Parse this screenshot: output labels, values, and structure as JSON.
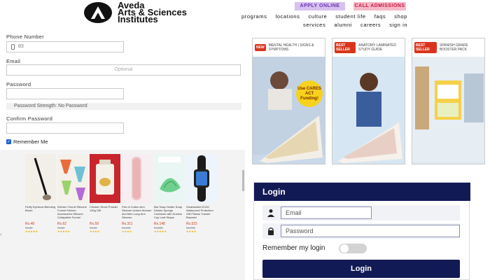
{
  "header": {
    "logo_text": "Aveda\nArts & Sciences\nInstitutes",
    "apply_label": "APPLY ONLINE",
    "call_label": "CALL ADMISSIONS",
    "nav_primary": [
      "programs",
      "locations",
      "culture",
      "student life",
      "faqs",
      "shop"
    ],
    "nav_secondary": [
      "services",
      "alumni",
      "careers",
      "sign in"
    ]
  },
  "form": {
    "phone_label": "Phone Number",
    "phone_value": "83",
    "email_label": "Email",
    "email_placeholder": "Optional",
    "password_label": "Password",
    "strength_text": "Password Strength: No Password",
    "confirm_label": "Confirm Password",
    "remember_label": "Remember Me",
    "remember_checked": true
  },
  "products": [
    {
      "name": "Fluffy Eyebrow Blending Brush",
      "price": "Rs.48",
      "old": "Rs.83",
      "stars": "★★★★★"
    },
    {
      "name": "Kitchen Funnel Silicone Funnel Kitchen Accessories Silicone Collapsible Funnel",
      "price": "Rs.62",
      "old": "Rs.85",
      "stars": "★★★★★"
    },
    {
      "name": "Chicken Stock Powder 100g Gift",
      "price": "Rs.59",
      "old": "Rs.88",
      "stars": "★★★★"
    },
    {
      "name": "Pair of Cotton Arm Sleeves Unisex Women and Men Long Arm Sleeves",
      "price": "Rs.311",
      "old": "Rs.440",
      "stars": "★★★★"
    },
    {
      "name": "Bar Soap Holder Soap Dishes Sponge Container with Suction Cup Leaf Shape",
      "price": "Rs.148",
      "old": "Rs.285",
      "stars": "★★★★★"
    },
    {
      "name": "Smartwatch ID116 Waterproof Protection Gift Fitness Tracker Bracelet",
      "price": "Rs.515",
      "old": "Rs.766",
      "stars": "★★★★"
    }
  ],
  "books": [
    {
      "badge": "NEW",
      "title": "MENTAL HEALTH | SIGNS & SYMPTOMS",
      "sticker": "Use CARES ACT Funding!",
      "bg": "#c9d8ea"
    },
    {
      "badge": "BEST SELLER",
      "title": "ANATOMY LAMINATED STUDY GUIDE",
      "sticker": "",
      "bg": "#d6e6f2"
    },
    {
      "badge": "BEST SELLER",
      "title": "SPANISH GRADE BOOSTER PACK",
      "sticker": "",
      "bg": "#dfe9f2"
    }
  ],
  "login": {
    "title": "Login",
    "email_placeholder": "Email",
    "password_placeholder": "Password",
    "remember_label": "Remember my login",
    "button_label": "Login"
  },
  "colors": {
    "login_navy": "#121a55",
    "apply_bg": "#d7c1ef",
    "call_bg": "#f5b9c9",
    "accent_red": "#d9341b"
  }
}
